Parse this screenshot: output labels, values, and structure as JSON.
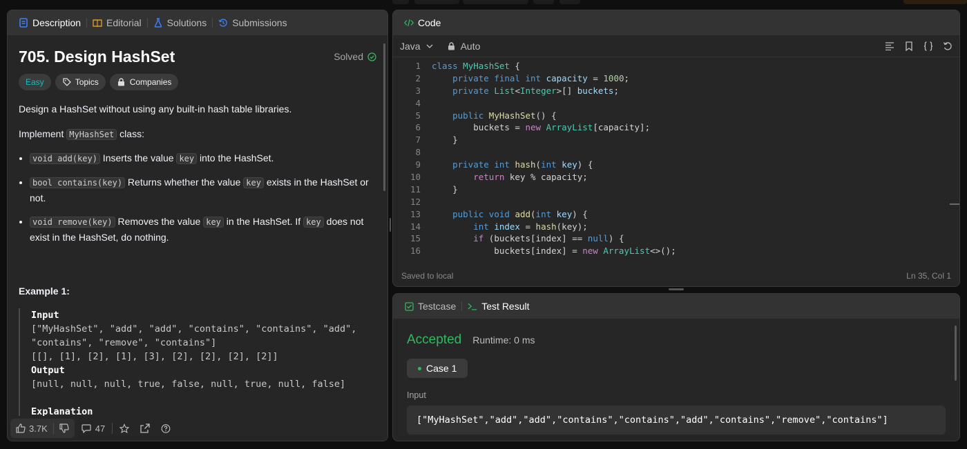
{
  "desc_tabs": [
    {
      "label": "Description",
      "icon": "description-icon"
    },
    {
      "label": "Editorial",
      "icon": "book-icon"
    },
    {
      "label": "Solutions",
      "icon": "flask-icon"
    },
    {
      "label": "Submissions",
      "icon": "history-icon"
    }
  ],
  "problem": {
    "title": "705. Design HashSet",
    "status": "Solved",
    "difficulty": "Easy",
    "topics_label": "Topics",
    "companies_label": "Companies",
    "intro": "Design a HashSet without using any built-in hash table libraries.",
    "implement_pre": "Implement ",
    "implement_code": "MyHashSet",
    "implement_post": " class:",
    "bullet1_code": "void add(key)",
    "bullet1_text1": " Inserts the value ",
    "bullet1_code2": "key",
    "bullet1_text2": " into the HashSet.",
    "bullet2_code": "bool contains(key)",
    "bullet2_text1": " Returns whether the value ",
    "bullet2_code2": "key",
    "bullet2_text2": " exists in the HashSet or not.",
    "bullet3_code": "void remove(key)",
    "bullet3_text1": " Removes the value ",
    "bullet3_code2": "key",
    "bullet3_text2": " in the HashSet. If ",
    "bullet3_code3": "key",
    "bullet3_text3": " does not exist in the HashSet, do nothing.",
    "example_heading": "Example 1:",
    "input_label": "Input",
    "input_line1": "[\"MyHashSet\", \"add\", \"add\", \"contains\", \"contains\", \"add\", \"contains\", \"remove\", \"contains\"]",
    "input_line2": "[[], [1], [2], [1], [3], [2], [2], [2], [2]]",
    "output_label": "Output",
    "output_line": "[null, null, null, true, false, null, true, null, false]",
    "explanation_label": "Explanation"
  },
  "bottom": {
    "likes": "3.7K",
    "comments": "47"
  },
  "code_panel": {
    "title": "Code",
    "language": "Java",
    "mode": "Auto",
    "footer_left": "Saved to local",
    "footer_right": "Ln 35, Col 1"
  },
  "code_lines": [
    "1",
    "2",
    "3",
    "4",
    "5",
    "6",
    "7",
    "8",
    "9",
    "10",
    "11",
    "12",
    "13",
    "14",
    "15",
    "16"
  ],
  "result_panel": {
    "tab_testcase": "Testcase",
    "tab_result": "Test Result",
    "verdict": "Accepted",
    "runtime": "Runtime: 0 ms",
    "case_label": "Case 1",
    "input_label": "Input",
    "input_value": "[\"MyHashSet\",\"add\",\"add\",\"contains\",\"contains\",\"add\",\"contains\",\"remove\",\"contains\"]"
  },
  "colors": {
    "accent_green": "#2cbb5d",
    "easy": "#1cbaba",
    "panel_bg": "#262626"
  }
}
